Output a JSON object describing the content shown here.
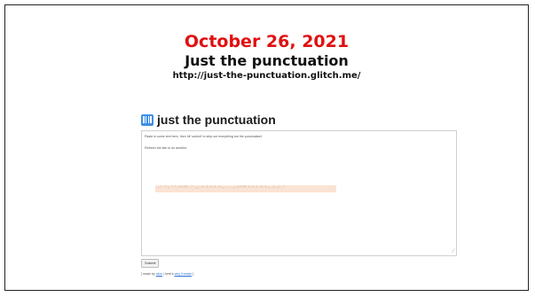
{
  "slide": {
    "date": "October 26, 2021",
    "title": "Just the punctuation",
    "url": "http://just-the-punctuation.glitch.me/"
  },
  "app": {
    "icon": "punctuation-bars-icon",
    "title": "just the punctuation",
    "instructions": "Paste in some text here, then hit 'submit' to strip out everything but the punctuation!",
    "refresh_note": "Refresh the site to do another.",
    "punctuation_output": ",'.'.,'.'.!!!?..'.,,.!.!.!.!.!.,....,,!!!?.!.!.!.!.!.,.!.,'.'",
    "submit_label": "Submit",
    "footer": {
      "prefix": "[ made by ",
      "author": "clive",
      "middle": " | here's ",
      "link": "why it exists",
      "suffix": " ]"
    }
  },
  "colors": {
    "date_red": "#e01010",
    "icon_blue": "#3d8fe8",
    "highlight": "#fbe3d4",
    "link_blue": "#2a6fd6"
  }
}
